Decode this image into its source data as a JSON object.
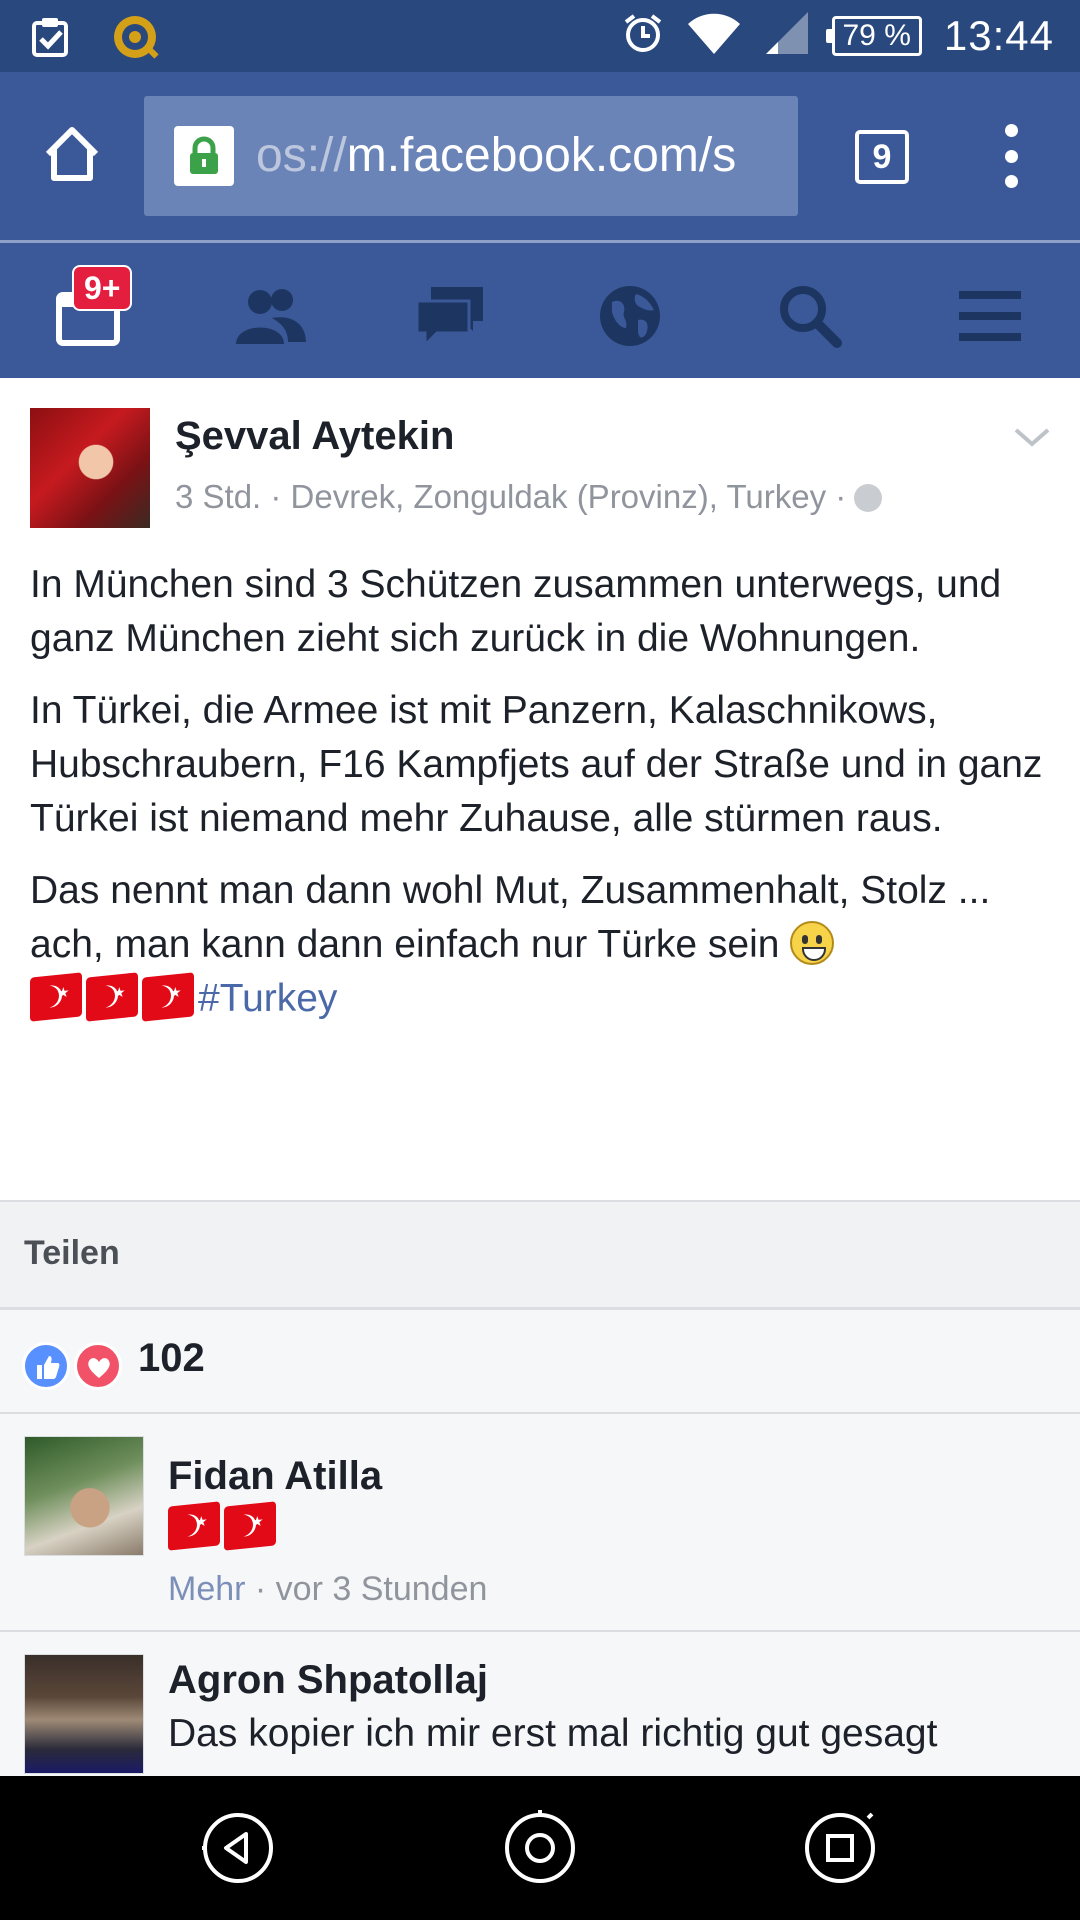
{
  "status_bar": {
    "battery": "79 %",
    "time": "13:44",
    "icons": [
      "clipboard-check-icon",
      "app-target-icon",
      "alarm-icon",
      "wifi-icon",
      "signal-icon",
      "battery-icon"
    ]
  },
  "browser": {
    "url_faded": "os://",
    "url_main": "m.facebook.com/s",
    "tab_count": "9"
  },
  "fb_nav": {
    "notifications_badge": "9+",
    "items": [
      "feed-icon",
      "friends-icon",
      "messages-icon",
      "globe-icon",
      "search-icon",
      "menu-icon"
    ]
  },
  "post": {
    "author": "Şevval Aytekin",
    "meta": "3 Std. · Devrek, Zonguldak (Provinz), Turkey ·",
    "paragraph1": "In München sind 3 Schützen zusammen unterwegs, und ganz München zieht sich zurück in die Wohnungen.",
    "paragraph2": "In Türkei, die Armee ist mit Panzern, Kalaschnikows, Hubschraubern, F16 Kampfjets auf der Straße und in ganz Türkei ist niemand mehr Zuhause, alle stürmen raus.",
    "paragraph3": "Das nennt man dann wohl Mut, Zusammenhalt, Stolz ... ach, man kann dann einfach nur Türke sein",
    "hashtag": "#Turkey"
  },
  "share": {
    "label": "Teilen"
  },
  "reactions": {
    "count": "102"
  },
  "comments": [
    {
      "name": "Fidan Atilla",
      "more": "Mehr",
      "time": " · vor 3 Stunden"
    },
    {
      "name": "Agron Shpatollaj",
      "text": "Das kopier ich mir erst mal richtig gut gesagt"
    }
  ],
  "colors": {
    "fb_blue": "#3b5998",
    "status_bar": "#29487d",
    "badge_red": "#e41e3f",
    "hashtag": "#4b69a8"
  }
}
